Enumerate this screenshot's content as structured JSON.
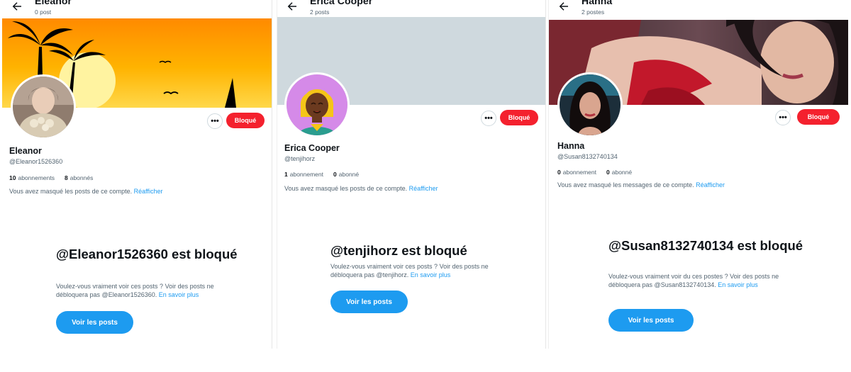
{
  "panels": [
    {
      "title": "Eleanor",
      "post_count": "0 post",
      "name": "Eleanor",
      "handle": "@Eleanor1526360",
      "following_count": "10",
      "following_label": "abonnements",
      "followers_count": "8",
      "followers_label": "abonnés",
      "hidden_text": "Vous avez masqué les posts de ce compte.",
      "show_link": "Réafficher",
      "block_label": "Bloqué",
      "more_label": "•••",
      "blocked_heading": "@Eleanor1526360 est bloqué",
      "blocked_desc": "Voulez-vous vraiment voir ces posts ? Voir des posts ne débloquera pas @Eleanor1526360.",
      "learn_more": "En savoir plus",
      "view_button": "Voir les posts"
    },
    {
      "title": "Erica Cooper",
      "post_count": "2 posts",
      "name": "Erica Cooper",
      "handle": "@tenjihorz",
      "following_count": "1",
      "following_label": "abonnement",
      "followers_count": "0",
      "followers_label": "abonné",
      "hidden_text": "Vous avez masqué les posts de ce compte.",
      "show_link": "Réafficher",
      "block_label": "Bloqué",
      "more_label": "•••",
      "blocked_heading": "@tenjihorz est bloqué",
      "blocked_desc": "Voulez-vous vraiment voir ces posts ? Voir des posts ne débloquera pas @tenjihorz.",
      "learn_more": "En savoir plus",
      "view_button": "Voir les posts"
    },
    {
      "title": "Hanna",
      "post_count": "2 postes",
      "name": "Hanna",
      "handle": "@Susan8132740134",
      "following_count": "0",
      "following_label": "abonnement",
      "followers_count": "0",
      "followers_label": "abonné",
      "hidden_text": "Vous avez masqué les messages de ce compte.",
      "show_link": "Réafficher",
      "block_label": "Bloqué",
      "more_label": "•••",
      "blocked_heading": "@Susan8132740134 est bloqué",
      "blocked_desc": "Voulez-vous vraiment voir du ces postes ? Voir des posts ne débloquera pas @Susan8132740134.",
      "learn_more": "En savoir plus",
      "view_button": "Voir les posts"
    }
  ],
  "colors": {
    "block_red": "#f4212e",
    "link_blue": "#1d9bf0",
    "muted_text": "#536471"
  }
}
